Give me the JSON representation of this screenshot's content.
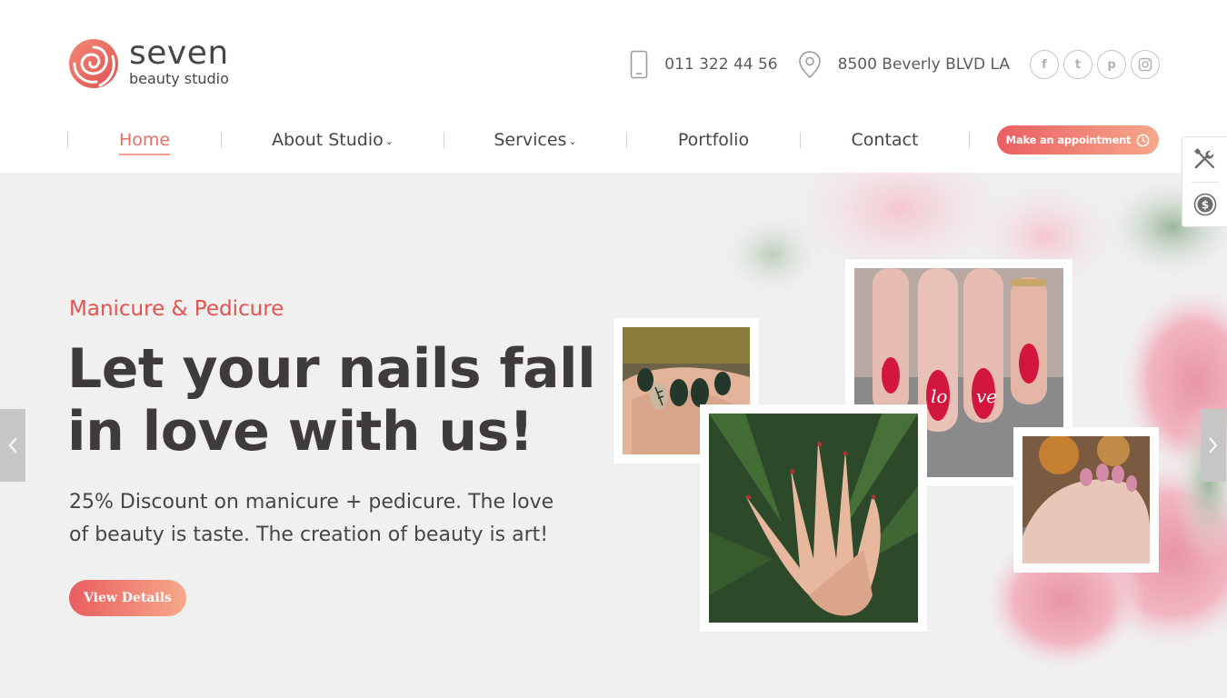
{
  "brand": {
    "name": "seven",
    "tagline": "beauty studio",
    "accent_color": "#ec6e66"
  },
  "contact": {
    "phone": "011 322 44 56",
    "address": "8500 Beverly BLVD LA",
    "phone_icon": "phone-icon",
    "address_icon": "map-pin-icon"
  },
  "social": [
    {
      "name": "facebook-icon",
      "glyph": "f"
    },
    {
      "name": "twitter-icon",
      "glyph": "t"
    },
    {
      "name": "pinterest-icon",
      "glyph": "p"
    },
    {
      "name": "instagram-icon",
      "glyph": "◘"
    }
  ],
  "nav": {
    "home": "Home",
    "about": "About Studio",
    "services": "Services",
    "portfolio": "Portfolio",
    "contact": "Contact",
    "appointment": "Make an appointment"
  },
  "hero": {
    "kicker": "Manicure & Pedicure",
    "title_line1": "Let your nails fall",
    "title_line2": "in love with us!",
    "description": "25% Discount on manicure + pedicure. The love of beauty is taste. The creation of beauty is art!",
    "cta": "View Details"
  },
  "side_tools": [
    "tools-icon",
    "dollar-icon"
  ]
}
